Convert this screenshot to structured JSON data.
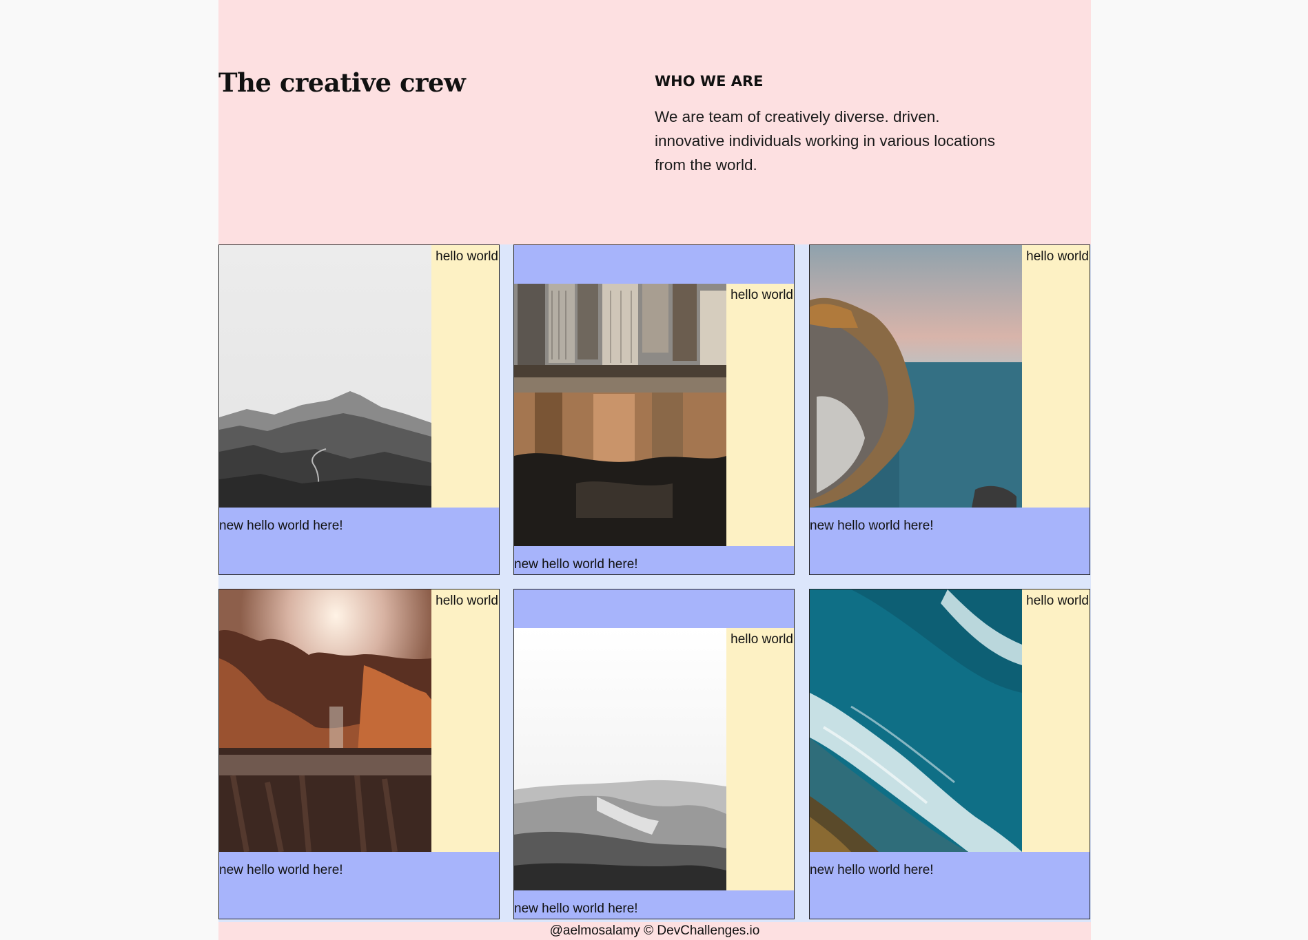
{
  "hero": {
    "title": "The creative crew"
  },
  "about": {
    "heading": "WHO WE ARE",
    "body": "We are team of creatively diverse. driven. innovative individuals working in various locations from the world."
  },
  "cards": [
    {
      "label": "hello world",
      "caption": "new hello world here!",
      "photo": "mountain-range-bw"
    },
    {
      "label": "hello world",
      "caption": "new hello world here!",
      "photo": "city-reflection-puddle"
    },
    {
      "label": "hello world",
      "caption": "new hello world here!",
      "photo": "sea-cliff-sunset"
    },
    {
      "label": "hello world",
      "caption": "new hello world here!",
      "photo": "autumn-forest-lake"
    },
    {
      "label": "hello world",
      "caption": "new hello world here!",
      "photo": "desert-dunes-bw"
    },
    {
      "label": "hello world",
      "caption": "new hello world here!",
      "photo": "ocean-waves-aerial"
    }
  ],
  "footer": {
    "credit": "@aelmosalamy © DevChallenges.io"
  },
  "colors": {
    "page_background": "#fde0e1",
    "grid_background": "#dce6fb",
    "card_background": "#a7b4fb",
    "card_panel": "#fdf1c4"
  }
}
